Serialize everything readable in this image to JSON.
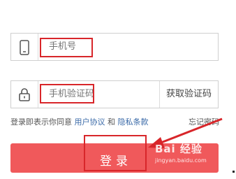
{
  "phone_field": {
    "placeholder": "手机号",
    "icon": "phone-icon"
  },
  "code_field": {
    "placeholder": "手机验证码",
    "icon": "lock-icon",
    "get_code_label": "获取验证码"
  },
  "agreement": {
    "prefix": "登录即表示你同意",
    "user_agreement": "用户协议",
    "conjunction": "和",
    "privacy": "隐私条款"
  },
  "forgot_password": "忘记密码",
  "login_button": "登录",
  "watermark": {
    "main": "Bai 经验",
    "sub": "jingyan.baidu.com"
  },
  "colors": {
    "button": "#f0595b",
    "annotation": "#d8262a",
    "link": "#3a6aa8"
  }
}
